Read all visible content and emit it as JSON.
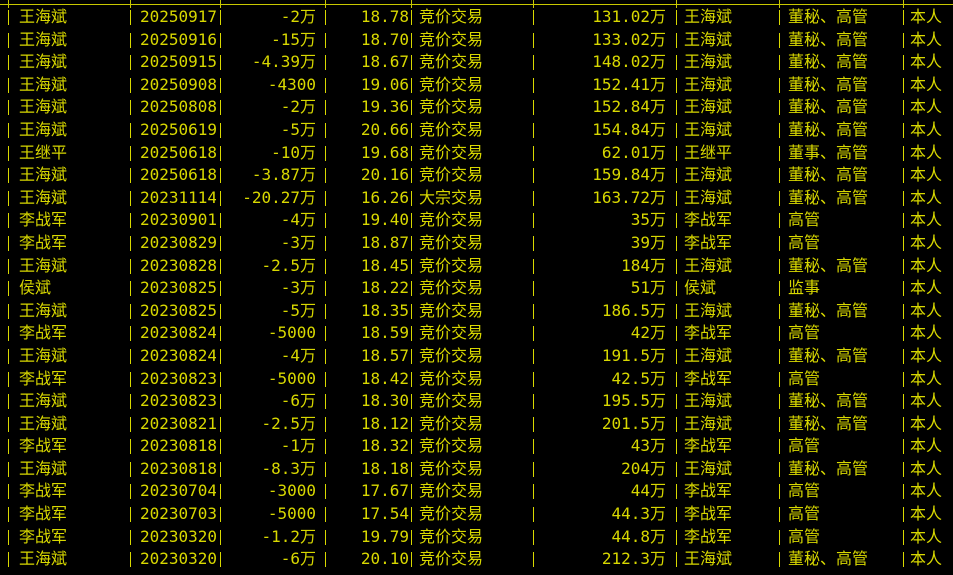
{
  "window": {
    "background": "#000000",
    "text_color": "#d8d800"
  },
  "table": {
    "rows": [
      {
        "name": "王海斌",
        "date": "20250917",
        "change": "-2万",
        "price": "18.78",
        "type": "竞价交易",
        "holding": "131.02万",
        "holder": "王海斌",
        "position": "董秘、高管",
        "relation": "本人"
      },
      {
        "name": "王海斌",
        "date": "20250916",
        "change": "-15万",
        "price": "18.70",
        "type": "竞价交易",
        "holding": "133.02万",
        "holder": "王海斌",
        "position": "董秘、高管",
        "relation": "本人"
      },
      {
        "name": "王海斌",
        "date": "20250915",
        "change": "-4.39万",
        "price": "18.67",
        "type": "竞价交易",
        "holding": "148.02万",
        "holder": "王海斌",
        "position": "董秘、高管",
        "relation": "本人"
      },
      {
        "name": "王海斌",
        "date": "20250908",
        "change": "-4300",
        "price": "19.06",
        "type": "竞价交易",
        "holding": "152.41万",
        "holder": "王海斌",
        "position": "董秘、高管",
        "relation": "本人"
      },
      {
        "name": "王海斌",
        "date": "20250808",
        "change": "-2万",
        "price": "19.36",
        "type": "竞价交易",
        "holding": "152.84万",
        "holder": "王海斌",
        "position": "董秘、高管",
        "relation": "本人"
      },
      {
        "name": "王海斌",
        "date": "20250619",
        "change": "-5万",
        "price": "20.66",
        "type": "竞价交易",
        "holding": "154.84万",
        "holder": "王海斌",
        "position": "董秘、高管",
        "relation": "本人"
      },
      {
        "name": "王继平",
        "date": "20250618",
        "change": "-10万",
        "price": "19.68",
        "type": "竞价交易",
        "holding": "62.01万",
        "holder": "王继平",
        "position": "董事、高管",
        "relation": "本人"
      },
      {
        "name": "王海斌",
        "date": "20250618",
        "change": "-3.87万",
        "price": "20.16",
        "type": "竞价交易",
        "holding": "159.84万",
        "holder": "王海斌",
        "position": "董秘、高管",
        "relation": "本人"
      },
      {
        "name": "王海斌",
        "date": "20231114",
        "change": "-20.27万",
        "price": "16.26",
        "type": "大宗交易",
        "holding": "163.72万",
        "holder": "王海斌",
        "position": "董秘、高管",
        "relation": "本人"
      },
      {
        "name": "李战军",
        "date": "20230901",
        "change": "-4万",
        "price": "19.40",
        "type": "竞价交易",
        "holding": "35万",
        "holder": "李战军",
        "position": "高管",
        "relation": "本人"
      },
      {
        "name": "李战军",
        "date": "20230829",
        "change": "-3万",
        "price": "18.87",
        "type": "竞价交易",
        "holding": "39万",
        "holder": "李战军",
        "position": "高管",
        "relation": "本人"
      },
      {
        "name": "王海斌",
        "date": "20230828",
        "change": "-2.5万",
        "price": "18.45",
        "type": "竞价交易",
        "holding": "184万",
        "holder": "王海斌",
        "position": "董秘、高管",
        "relation": "本人"
      },
      {
        "name": "侯斌",
        "date": "20230825",
        "change": "-3万",
        "price": "18.22",
        "type": "竞价交易",
        "holding": "51万",
        "holder": "侯斌",
        "position": "监事",
        "relation": "本人"
      },
      {
        "name": "王海斌",
        "date": "20230825",
        "change": "-5万",
        "price": "18.35",
        "type": "竞价交易",
        "holding": "186.5万",
        "holder": "王海斌",
        "position": "董秘、高管",
        "relation": "本人"
      },
      {
        "name": "李战军",
        "date": "20230824",
        "change": "-5000",
        "price": "18.59",
        "type": "竞价交易",
        "holding": "42万",
        "holder": "李战军",
        "position": "高管",
        "relation": "本人"
      },
      {
        "name": "王海斌",
        "date": "20230824",
        "change": "-4万",
        "price": "18.57",
        "type": "竞价交易",
        "holding": "191.5万",
        "holder": "王海斌",
        "position": "董秘、高管",
        "relation": "本人"
      },
      {
        "name": "李战军",
        "date": "20230823",
        "change": "-5000",
        "price": "18.42",
        "type": "竞价交易",
        "holding": "42.5万",
        "holder": "李战军",
        "position": "高管",
        "relation": "本人"
      },
      {
        "name": "王海斌",
        "date": "20230823",
        "change": "-6万",
        "price": "18.30",
        "type": "竞价交易",
        "holding": "195.5万",
        "holder": "王海斌",
        "position": "董秘、高管",
        "relation": "本人"
      },
      {
        "name": "王海斌",
        "date": "20230821",
        "change": "-2.5万",
        "price": "18.12",
        "type": "竞价交易",
        "holding": "201.5万",
        "holder": "王海斌",
        "position": "董秘、高管",
        "relation": "本人"
      },
      {
        "name": "李战军",
        "date": "20230818",
        "change": "-1万",
        "price": "18.32",
        "type": "竞价交易",
        "holding": "43万",
        "holder": "李战军",
        "position": "高管",
        "relation": "本人"
      },
      {
        "name": "王海斌",
        "date": "20230818",
        "change": "-8.3万",
        "price": "18.18",
        "type": "竞价交易",
        "holding": "204万",
        "holder": "王海斌",
        "position": "董秘、高管",
        "relation": "本人"
      },
      {
        "name": "李战军",
        "date": "20230704",
        "change": "-3000",
        "price": "17.67",
        "type": "竞价交易",
        "holding": "44万",
        "holder": "李战军",
        "position": "高管",
        "relation": "本人"
      },
      {
        "name": "李战军",
        "date": "20230703",
        "change": "-5000",
        "price": "17.54",
        "type": "竞价交易",
        "holding": "44.3万",
        "holder": "李战军",
        "position": "高管",
        "relation": "本人"
      },
      {
        "name": "李战军",
        "date": "20230320",
        "change": "-1.2万",
        "price": "19.79",
        "type": "竞价交易",
        "holding": "44.8万",
        "holder": "李战军",
        "position": "高管",
        "relation": "本人"
      },
      {
        "name": "王海斌",
        "date": "20230320",
        "change": "-6万",
        "price": "20.10",
        "type": "竞价交易",
        "holding": "212.3万",
        "holder": "王海斌",
        "position": "董秘、高管",
        "relation": "本人"
      }
    ]
  }
}
